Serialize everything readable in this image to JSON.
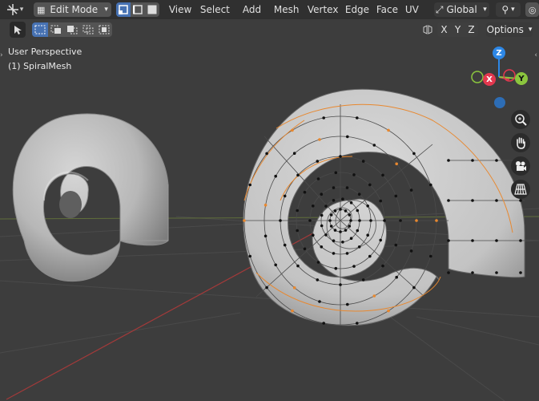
{
  "header": {
    "mode_label": "Edit Mode",
    "menus": [
      "View",
      "Select",
      "Add",
      "Mesh",
      "Vertex",
      "Edge",
      "Face",
      "UV"
    ],
    "orientation_label": "Global"
  },
  "toolbar": {
    "axis_x": "X",
    "axis_y": "Y",
    "axis_z": "Z",
    "options_label": "Options"
  },
  "overlay": {
    "perspective_label": "User Perspective",
    "object_label": "(1) SpiralMesh"
  },
  "gizmo": {
    "z": "Z",
    "x": "X",
    "y": "Y",
    "colors": {
      "x": "#e4384f",
      "y": "#8bc53e",
      "z": "#2d87e6"
    }
  },
  "icons": [
    "transform-pivot-icon",
    "dropdown-icon",
    "select-box-icon",
    "select-extend-icon",
    "select-subtract-icon",
    "select-invert-icon",
    "select-intersect-icon",
    "vertex-select-icon",
    "edge-select-icon",
    "face-select-icon",
    "orientation-icon",
    "snap-icon",
    "proportional-edit-icon",
    "mirror-icon",
    "zoom-icon",
    "pan-hand-icon",
    "camera-icon",
    "grid-perspective-icon"
  ]
}
